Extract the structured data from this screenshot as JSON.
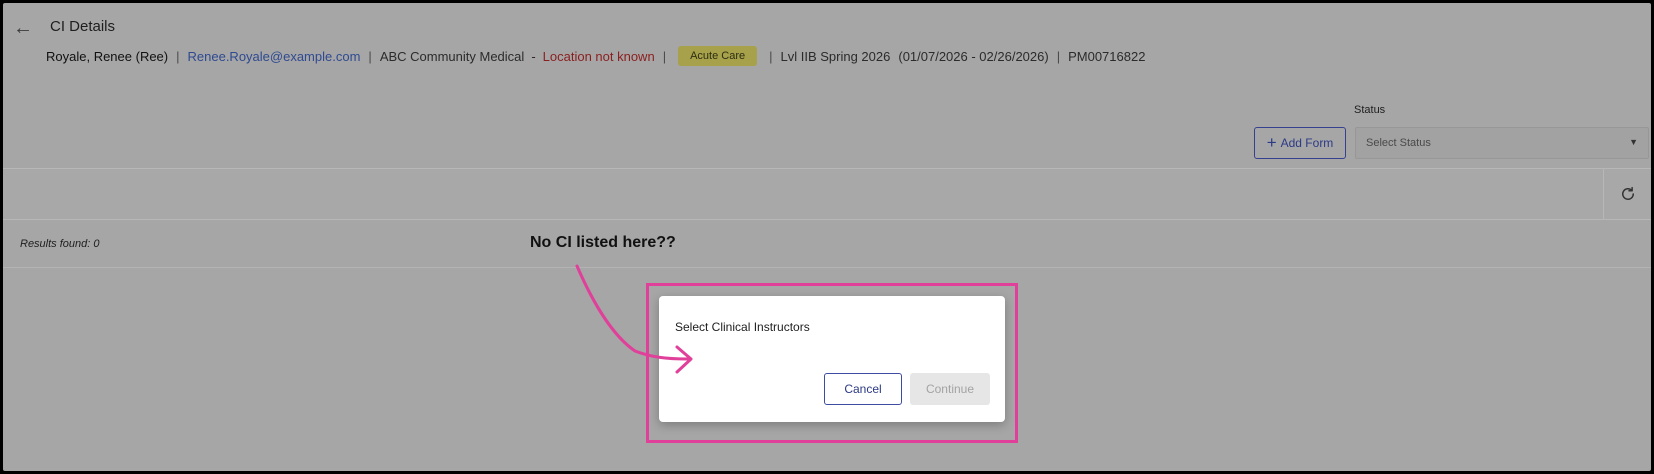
{
  "header": {
    "title": "CI Details",
    "student_name": "Royale, Renee (Ree)",
    "email": "Renee.Royale@example.com",
    "site": "ABC Community Medical",
    "site_dash": "-",
    "location_status": "Location not known",
    "setting_badge": "Acute Care",
    "course": "Lvl IIB Spring 2026",
    "dates": "(01/07/2026 - 02/26/2026)",
    "placement_id": "PM00716822",
    "separator": "|"
  },
  "toolbar": {
    "add_form_label": "Add Form",
    "status_label": "Status",
    "status_placeholder": "Select Status"
  },
  "results": {
    "count_text": "Results found: 0"
  },
  "annotation": {
    "text": "No CI listed here??"
  },
  "modal": {
    "title": "Select Clinical Instructors",
    "cancel_label": "Cancel",
    "continue_label": "Continue"
  },
  "colors": {
    "highlight": "#e0409a",
    "badge": "#a6a14a",
    "primary": "#2c3a86",
    "error_text": "#8b1f1f"
  },
  "icons": {
    "back": "left-arrow-icon",
    "refresh": "refresh-icon",
    "dropdown": "caret-down-icon",
    "add": "plus-icon"
  }
}
